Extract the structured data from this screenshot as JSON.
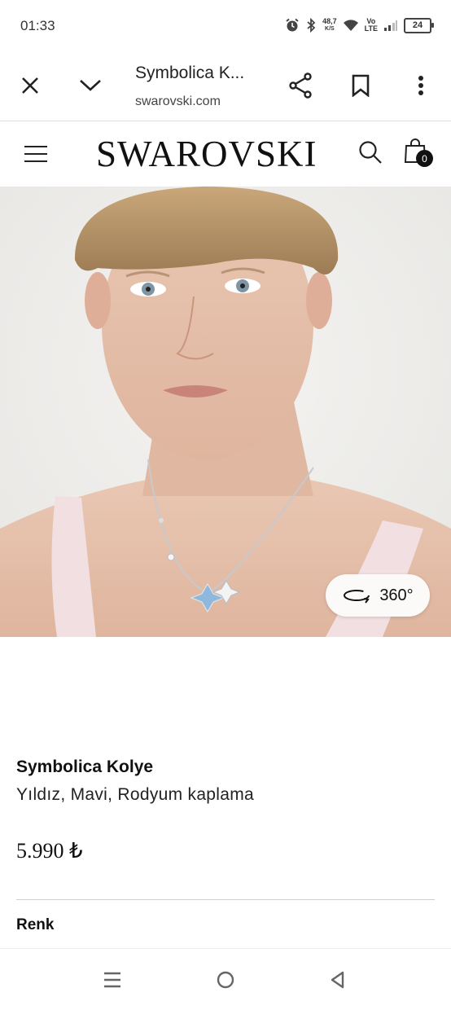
{
  "status": {
    "time": "01:33",
    "net_speed_value": "48,7",
    "net_speed_unit": "K/S",
    "network_top": "Vo",
    "network_bottom": "LTE",
    "battery": "24"
  },
  "browser": {
    "title": "Symbolica K...",
    "url": "swarovski.com"
  },
  "site": {
    "logo": "SWAROVSKI",
    "cart_count": "0"
  },
  "hero": {
    "view_360_label": "360°"
  },
  "product": {
    "name": "Symbolica Kolye",
    "subtitle": "Yıldız, Mavi, Rodyum kaplama",
    "price": "5.990 ₺",
    "color_label": "Renk"
  },
  "icons": {
    "close": "close-icon",
    "collapse": "chevron-down-icon",
    "share": "share-icon",
    "bookmark": "bookmark-icon",
    "more": "more-vert-icon",
    "menu": "hamburger-menu-icon",
    "search": "search-icon",
    "cart": "shopping-bag-icon",
    "rotate": "rotate-360-icon",
    "nav_recents": "recents-icon",
    "nav_home": "home-icon",
    "nav_back": "back-icon"
  }
}
